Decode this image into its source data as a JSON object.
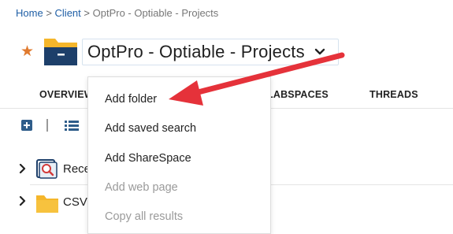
{
  "breadcrumb": {
    "home": "Home",
    "separator": ">",
    "client": "Client",
    "current": "OptPro - Optiable - Projects"
  },
  "header": {
    "title": "OptPro - Optiable - Projects"
  },
  "tabs": {
    "overview": "OVERVIEW",
    "labspaces": "LABSPACES",
    "threads": "THREADS"
  },
  "rows": [
    {
      "label": "Rece"
    },
    {
      "label": "CSV"
    }
  ],
  "menu": {
    "items": [
      {
        "label": "Add folder",
        "enabled": true
      },
      {
        "label": "Add saved search",
        "enabled": true
      },
      {
        "label": "Add ShareSpace",
        "enabled": true
      },
      {
        "label": "Add web page",
        "enabled": false
      },
      {
        "label": "Copy all results",
        "enabled": false
      }
    ]
  },
  "colors": {
    "link": "#1f5fa6",
    "star": "#e07a2e",
    "folder_yellow": "#f5b62b",
    "folder_dark": "#1d3f6a",
    "annotation_arrow": "#e5323a",
    "disabled_text": "#9a9a9a"
  },
  "icons": {
    "favorite": "star-icon",
    "title_folder": "folder-icon",
    "title_dropdown": "chevron-down-icon",
    "add": "plus-square-icon",
    "list": "list-view-icon",
    "recent": "saved-search-icon",
    "csv": "folder-icon",
    "pointer": "annotation-arrow"
  }
}
